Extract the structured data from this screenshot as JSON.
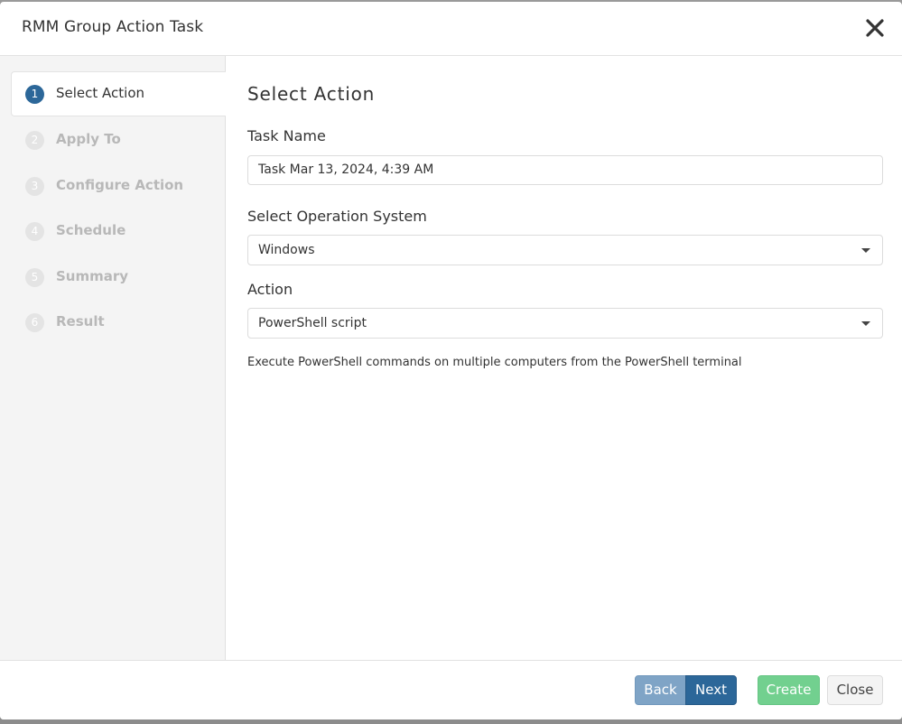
{
  "dialog": {
    "title": "RMM Group Action Task",
    "close_icon": "close-x-icon"
  },
  "steps": [
    {
      "number": "1",
      "label": "Select Action",
      "active": true
    },
    {
      "number": "2",
      "label": "Apply To",
      "active": false
    },
    {
      "number": "3",
      "label": "Configure Action",
      "active": false
    },
    {
      "number": "4",
      "label": "Schedule",
      "active": false
    },
    {
      "number": "5",
      "label": "Summary",
      "active": false
    },
    {
      "number": "6",
      "label": "Result",
      "active": false
    }
  ],
  "content": {
    "title": "Select Action",
    "task_name": {
      "label": "Task Name",
      "value": "Task Mar 13, 2024, 4:39 AM"
    },
    "operating_system": {
      "label": "Select Operation System",
      "selected": "Windows"
    },
    "action": {
      "label": "Action",
      "selected": "PowerShell script"
    },
    "description": "Execute PowerShell commands on multiple computers from the PowerShell terminal"
  },
  "footer": {
    "back_label": "Back",
    "next_label": "Next",
    "create_label": "Create",
    "close_label": "Close"
  },
  "colors": {
    "primary": "#2c6799",
    "primary_disabled": "#7fa4c6",
    "success_disabled": "#72d08f",
    "sidebar_bg": "#f4f4f4"
  }
}
